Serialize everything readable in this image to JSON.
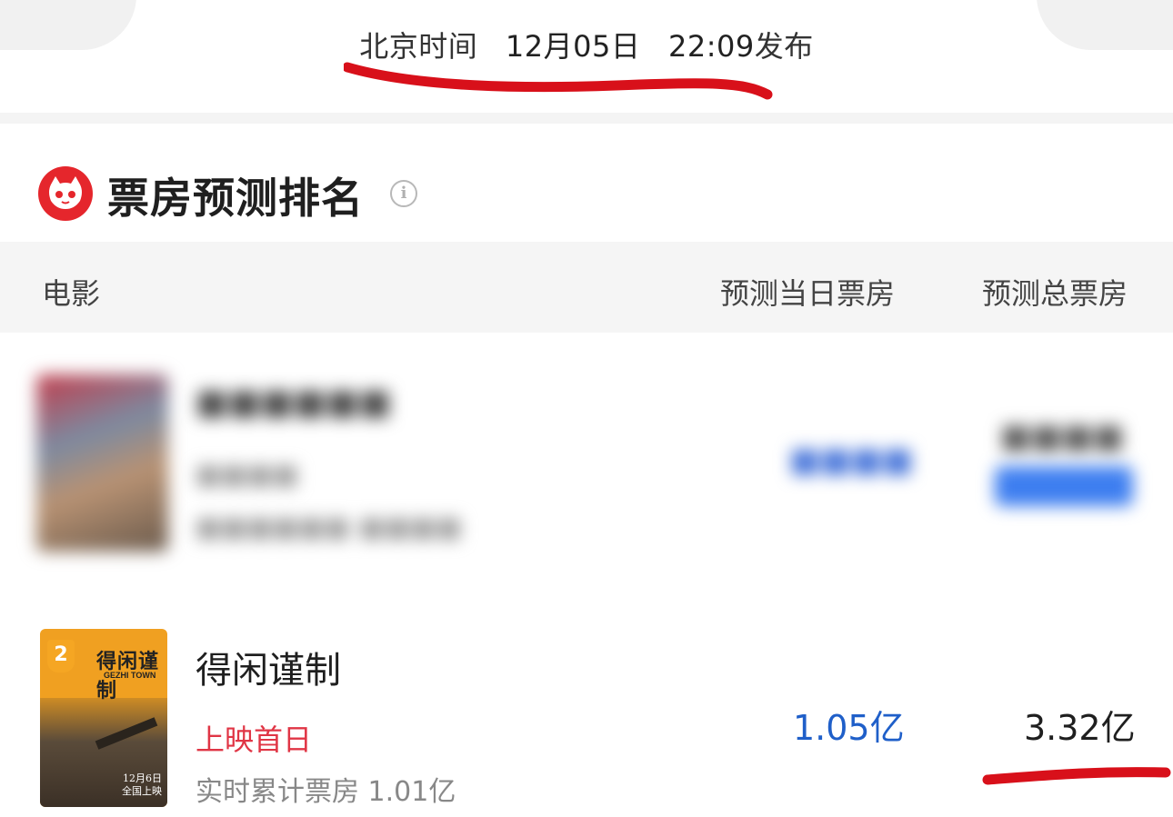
{
  "publish": {
    "label": "北京时间",
    "date": "12月05日",
    "time": "22:09",
    "suffix": "发布"
  },
  "section": {
    "title": "票房预测排名",
    "info_icon": "info-icon",
    "logo_icon": "cat-eye-logo-icon"
  },
  "table": {
    "columns": {
      "movie": "电影",
      "day_forecast": "预测当日票房",
      "total_forecast": "预测总票房"
    }
  },
  "rows": [
    {
      "rank": "2",
      "title": "得闲谨制",
      "status": "上映首日",
      "cumulative_label": "实时累计票房",
      "cumulative_value": "1.01亿",
      "day_forecast": "1.05亿",
      "total_forecast": "3.32亿",
      "poster": {
        "title": "得闲谨制",
        "subtitle": "GEZHI TOWN",
        "date_line1": "12月6日",
        "date_line2": "全国上映"
      }
    }
  ],
  "colors": {
    "accent_blue": "#1f5fc9",
    "status_red": "#e03545",
    "annotation_red": "#d8101a",
    "rank_badge": "#f5a623"
  }
}
